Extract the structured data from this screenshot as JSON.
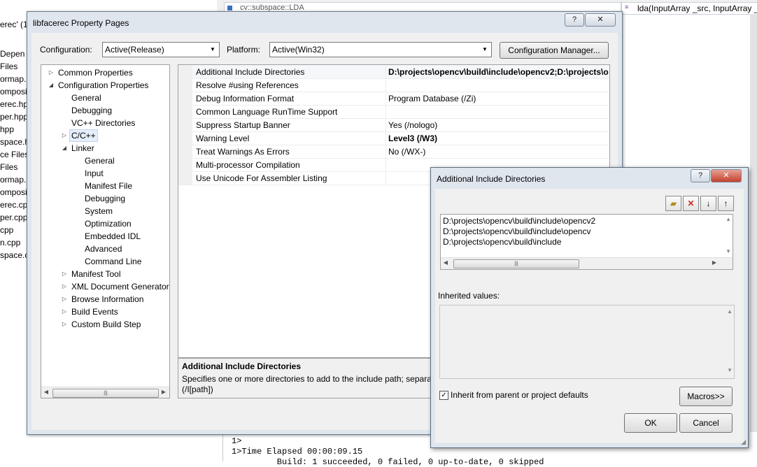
{
  "background": {
    "left_strip": [
      "erec' (1",
      "Depen",
      "Files",
      "ormap.h",
      "omposi",
      "erec.hpp",
      "per.hpp",
      "hpp",
      "space.h",
      "ce Files",
      "Files",
      "ormap.c",
      "omposi",
      "erec.cpp",
      "per.cpp",
      "cpp",
      "n.cpp",
      "space.c"
    ],
    "editor_combo_left": "cv::subspace::LDA",
    "editor_combo_right": "lda(InputArray _src, InputArray _l",
    "output_lines": [
      "1>",
      "1>Time Elapsed 00:00:09.15",
      "         Build: 1 succeeded, 0 failed, 0 up-to-date, 0 skipped"
    ]
  },
  "main_dialog": {
    "title": "libfacerec Property Pages",
    "help_glyph": "?",
    "close_glyph": "✕",
    "configuration_label": "Configuration:",
    "configuration_value": "Active(Release)",
    "platform_label": "Platform:",
    "platform_value": "Active(Win32)",
    "config_manager_button": "Configuration Manager...",
    "tree": [
      {
        "label": "Common Properties",
        "level": 0,
        "expander": "collapsed"
      },
      {
        "label": "Configuration Properties",
        "level": 0,
        "expander": "expanded"
      },
      {
        "label": "General",
        "level": 1
      },
      {
        "label": "Debugging",
        "level": 1
      },
      {
        "label": "VC++ Directories",
        "level": 1
      },
      {
        "label": "C/C++",
        "level": 1,
        "expander": "collapsed",
        "selected": true
      },
      {
        "label": "Linker",
        "level": 1,
        "expander": "expanded"
      },
      {
        "label": "General",
        "level": 2
      },
      {
        "label": "Input",
        "level": 2
      },
      {
        "label": "Manifest File",
        "level": 2
      },
      {
        "label": "Debugging",
        "level": 2
      },
      {
        "label": "System",
        "level": 2
      },
      {
        "label": "Optimization",
        "level": 2
      },
      {
        "label": "Embedded IDL",
        "level": 2
      },
      {
        "label": "Advanced",
        "level": 2
      },
      {
        "label": "Command Line",
        "level": 2
      },
      {
        "label": "Manifest Tool",
        "level": 1,
        "expander": "collapsed"
      },
      {
        "label": "XML Document Generator",
        "level": 1,
        "expander": "collapsed"
      },
      {
        "label": "Browse Information",
        "level": 1,
        "expander": "collapsed"
      },
      {
        "label": "Build Events",
        "level": 1,
        "expander": "collapsed"
      },
      {
        "label": "Custom Build Step",
        "level": 1,
        "expander": "collapsed"
      }
    ],
    "properties": [
      {
        "name": "Additional Include Directories",
        "value": "D:\\projects\\opencv\\build\\include\\opencv2;D:\\projects\\o",
        "bold": true
      },
      {
        "name": "Resolve #using References",
        "value": ""
      },
      {
        "name": "Debug Information Format",
        "value": "Program Database (/Zi)"
      },
      {
        "name": "Common Language RunTime Support",
        "value": ""
      },
      {
        "name": "Suppress Startup Banner",
        "value": "Yes (/nologo)"
      },
      {
        "name": "Warning Level",
        "value": "Level3 (/W3)",
        "bold": true
      },
      {
        "name": "Treat Warnings As Errors",
        "value": "No (/WX-)"
      },
      {
        "name": "Multi-processor Compilation",
        "value": ""
      },
      {
        "name": "Use Unicode For Assembler Listing",
        "value": ""
      }
    ],
    "description_title": "Additional Include Directories",
    "description_text": "Specifies one or more directories to add to the include path; separat",
    "description_text2": "(/I[path])"
  },
  "sub_dialog": {
    "title": "Additional Include Directories",
    "help_glyph": "?",
    "close_glyph": "✕",
    "directories": [
      "D:\\projects\\opencv\\build\\include\\opencv2",
      "D:\\projects\\opencv\\build\\include\\opencv",
      "D:\\projects\\opencv\\build\\include"
    ],
    "inherited_label": "Inherited values:",
    "inherit_checkbox_label": "Inherit from parent or project defaults",
    "inherit_checked": true,
    "macros_button": "Macros>>",
    "ok_button": "OK",
    "cancel_button": "Cancel",
    "icons": [
      "new-folder-icon",
      "delete-icon",
      "move-down-icon",
      "move-up-icon"
    ]
  },
  "colors": {
    "dialog_frame": "#dfe6ee",
    "client_bg": "#f0f0f0",
    "selection": "#e5eefa"
  }
}
